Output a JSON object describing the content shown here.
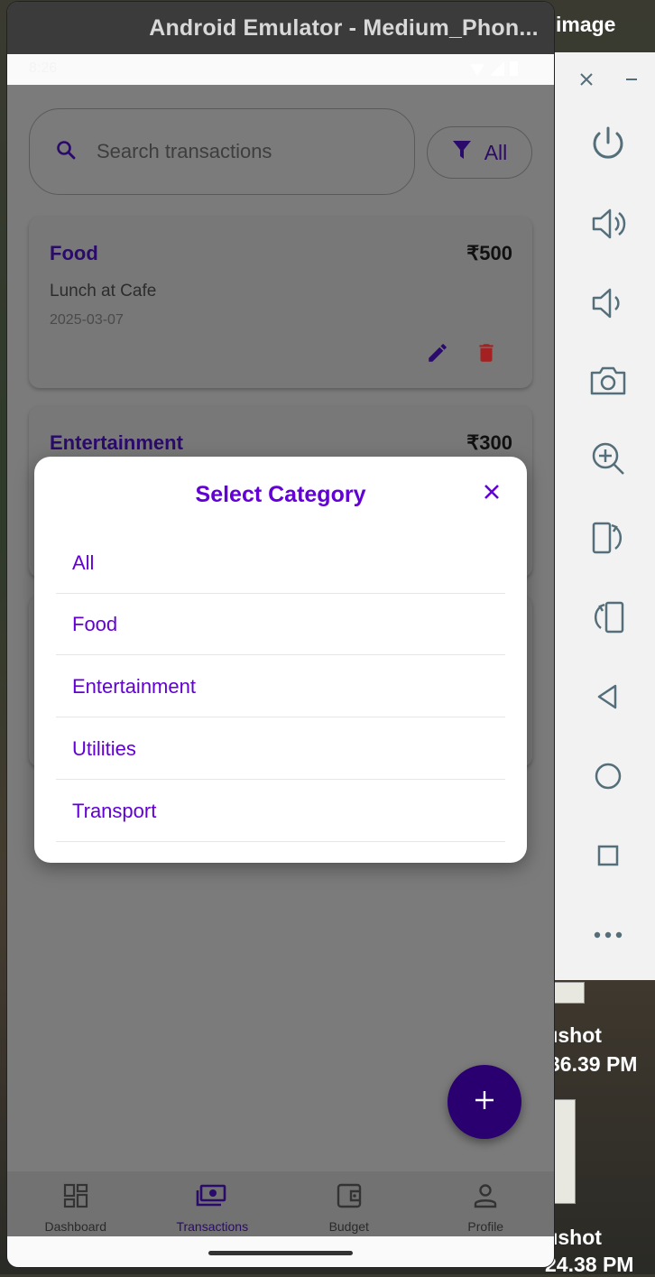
{
  "window": {
    "title": "Android Emulator - Medium_Phon..."
  },
  "desktop": {
    "title_fragment": "image",
    "item1_line1": "ıshot",
    "item1_line2": "36.39 PM",
    "item2_line1": "ıshot",
    "item2_line2": "24.38 PM"
  },
  "status_bar": {
    "time": "8:26"
  },
  "search": {
    "placeholder": "Search transactions",
    "icon": "search-icon"
  },
  "filter": {
    "label": "All",
    "icon": "filter-icon"
  },
  "transactions": [
    {
      "category": "Food",
      "amount": "₹500",
      "description": "Lunch at Cafe",
      "date": "2025-03-07"
    },
    {
      "category": "Entertainment",
      "amount": "₹300"
    }
  ],
  "dialog": {
    "title": "Select Category",
    "options": [
      "All",
      "Food",
      "Entertainment",
      "Utilities",
      "Transport"
    ]
  },
  "bottom_nav": {
    "items": [
      {
        "label": "Dashboard",
        "icon": "dashboard-icon"
      },
      {
        "label": "Transactions",
        "icon": "transactions-icon",
        "active": true
      },
      {
        "label": "Budget",
        "icon": "wallet-icon"
      },
      {
        "label": "Profile",
        "icon": "person-icon"
      }
    ]
  },
  "colors": {
    "accent": "#6200D6",
    "delete": "#C62828",
    "fab": "#2A0070"
  }
}
